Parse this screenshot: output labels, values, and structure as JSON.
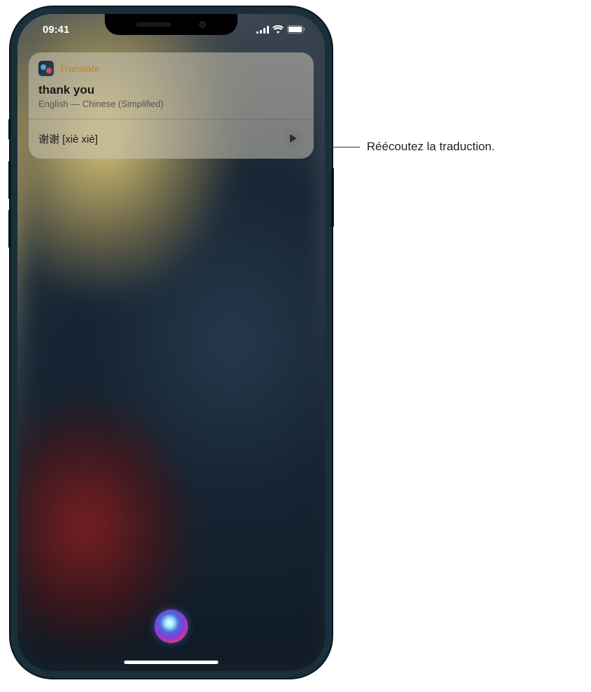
{
  "status": {
    "time": "09:41"
  },
  "card": {
    "app_name": "Translate",
    "source_text": "thank you",
    "language_pair": "English — Chinese (Simplified)",
    "translation": "谢谢 [xiè xiè]"
  },
  "callout": {
    "text": "Réécoutez la traduction."
  }
}
